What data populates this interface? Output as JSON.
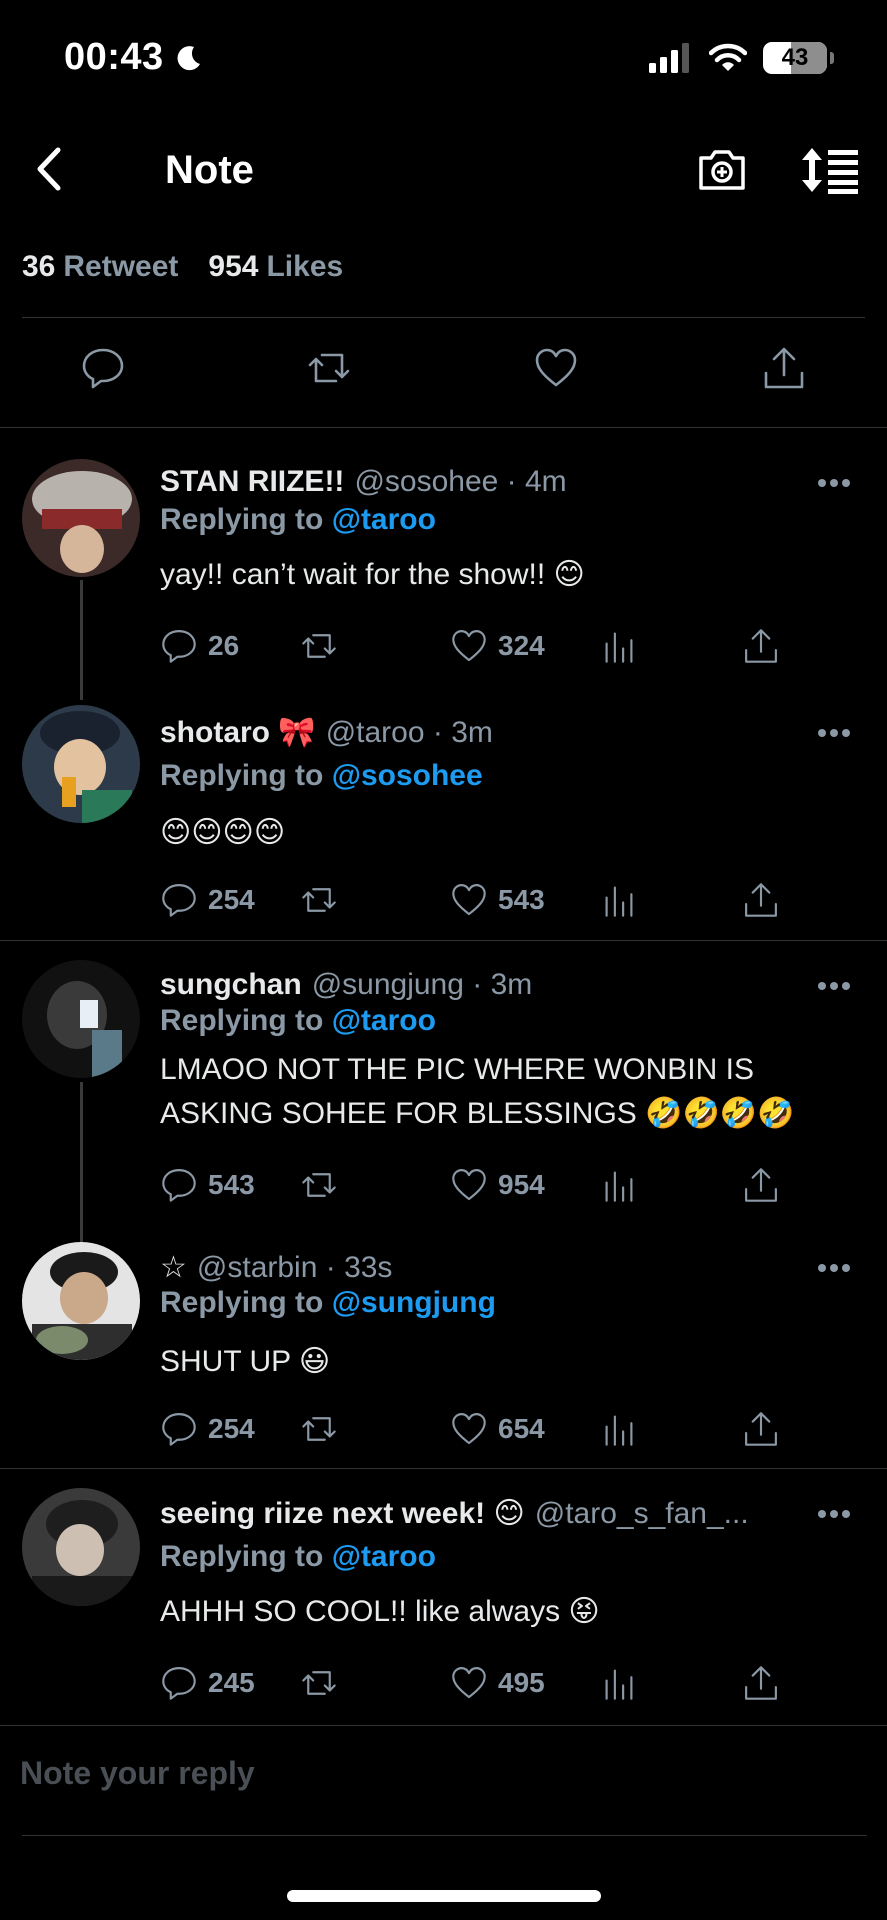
{
  "status_bar": {
    "time": "00:43",
    "battery": "43",
    "battery_level": 0.43
  },
  "header": {
    "title": "Note",
    "icons": [
      "back-icon",
      "camera-plus-icon",
      "sort-icon"
    ]
  },
  "stats": {
    "retweets": "36",
    "retweets_label": "Retweet",
    "likes": "954",
    "likes_label": "Likes"
  },
  "actions": [
    "reply-icon",
    "retweet-icon",
    "heart-icon",
    "share-icon"
  ],
  "replies": [
    {
      "name": "STAN RIIZE!!",
      "handle": "@sosohee · 4m",
      "replying_prefix": "Replying to",
      "replying_to": "@taroo",
      "text": "yay!! can’t wait for the show!! 😊",
      "replies": "26",
      "likes": "324",
      "avatar_colors": [
        "#4a2a2a",
        "#c9c3bf"
      ]
    },
    {
      "name": "shotaro 🎀",
      "handle": "@taroo · 3m",
      "replying_prefix": "Replying to",
      "replying_to": "@sosohee",
      "text": "😊😊😊😊",
      "replies": "254",
      "likes": "543",
      "avatar_colors": [
        "#2c3a4a",
        "#d9b38c"
      ]
    },
    {
      "name": "sungchan",
      "handle": "@sungjung · 3m",
      "replying_prefix": "Replying to",
      "replying_to": "@taroo",
      "text": " LMAOO NOT THE PIC WHERE WONBIN IS ASKING SOHEE FOR BLESSINGS 🤣🤣🤣🤣",
      "replies": "543",
      "likes": "954",
      "avatar_colors": [
        "#1a1a1a",
        "#7a8088"
      ]
    },
    {
      "name": "☆",
      "handle": "@starbin · 33s",
      "replying_prefix": "Replying to",
      "replying_to": "@sungjung",
      "text": "SHUT UP 😃",
      "replies": "254",
      "likes": "654",
      "avatar_colors": [
        "#e8e8e8",
        "#2a3a2a"
      ]
    },
    {
      "name": "seeing riize next week! 😊",
      "handle": "@taro_s_fan_...",
      "replying_prefix": "Replying to",
      "replying_to": "@taroo",
      "text": "AHHH SO COOL!! like always 😝",
      "replies": "245",
      "likes": "495",
      "avatar_colors": [
        "#3a3a3a",
        "#c8c0b8"
      ]
    }
  ],
  "reply_input": {
    "placeholder": "Note your reply"
  }
}
